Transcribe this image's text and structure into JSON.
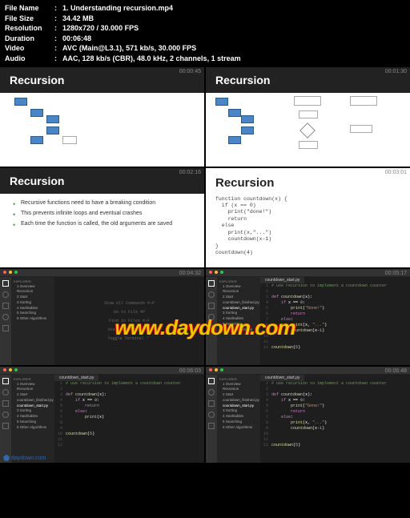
{
  "meta": {
    "labels": {
      "filename": "File Name",
      "filesize": "File Size",
      "resolution": "Resolution",
      "duration": "Duration",
      "video": "Video",
      "audio": "Audio"
    },
    "filename": "1. Understanding recursion.mp4",
    "filesize": "34.42 MB",
    "resolution": "1280x720 / 30.000 FPS",
    "duration": "00:06:48",
    "video": "AVC (Main@L3.1), 571 kb/s, 30.000 FPS",
    "audio": "AAC, 128 kb/s (CBR), 48.0 kHz, 2 channels, 1 stream"
  },
  "timestamps": [
    "00:00:45",
    "00:01:30",
    "00:02:16",
    "00:03:01",
    "00:04:32",
    "00:05:17",
    "00:06:03",
    "00:06:48"
  ],
  "slides": {
    "title": "Recursion",
    "bullets": [
      "Recursive functions need to have a breaking condition",
      "This prevents infinite loops and eventual crashes",
      "Each time the function is called, the old arguments are saved"
    ],
    "code": "function countdown(x) {\n  if (x == 0)\n    print(\"done!\")\n    return\n  else\n    print(x,\"...\")\n    countdown(x-1)\n}\ncountdown(4)"
  },
  "ide": {
    "tab": "countdown_start.py",
    "explorer_title": "EXPLORER",
    "folders": [
      "1 Overview",
      "Recursion",
      "2 Start",
      "countdown_finished.py",
      "countdown_start.py",
      "3 Sorting",
      "4 Hashtables",
      "5 Searching",
      "6 Other Algorithms"
    ],
    "comment": "# use recursion to implement a countdown counter",
    "lines": [
      "1",
      "2",
      "3",
      "4",
      "5",
      "6",
      "7",
      "8",
      "9",
      "10",
      "11",
      "12"
    ],
    "code_def": "def countdown(x):",
    "code_if": "    if x == 0:",
    "code_print_done": "        print(\"Done!\")",
    "code_return": "        return",
    "code_else": "    else:",
    "code_print_x": "        print(x, \"...\")",
    "code_recurse": "        countdown(x-1)",
    "code_call": "countdown(5)",
    "code_print_simple": "    print(x)",
    "welcome": {
      "l1": "Show All Commands  ⌘⇧P",
      "l2": "Go to File  ⌘P",
      "l3": "Find in Files  ⌘⇧F",
      "l4": "Start Debugging  F5",
      "l5": "Toggle Terminal  ⌃`"
    }
  },
  "watermark": "www.daydown.com",
  "footer_logo": "daydown.com"
}
